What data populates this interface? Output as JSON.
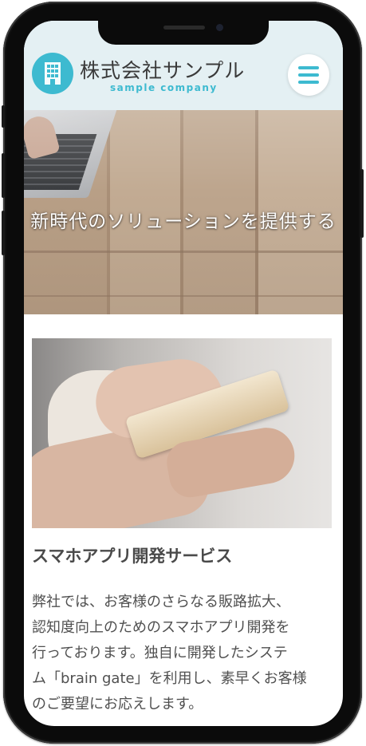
{
  "header": {
    "logo_icon": "building-icon",
    "brand_name": "株式会社サンプル",
    "brand_sub": "sample company",
    "menu_icon": "hamburger-menu-icon",
    "accent_color": "#3dbad0",
    "background_color": "#e4f0f3"
  },
  "hero": {
    "title": "新時代のソリューションを提供する"
  },
  "service": {
    "title": "スマホアプリ開発サービス",
    "body_lines": [
      "弊社では、お客様のさらなる販路拡大、",
      "認知度向上のためのスマホアプリ開発を",
      "行っております。独自に開発したシステ",
      "ム「brain gate」を利用し、素早くお客様",
      "のご要望にお応えします。"
    ]
  }
}
